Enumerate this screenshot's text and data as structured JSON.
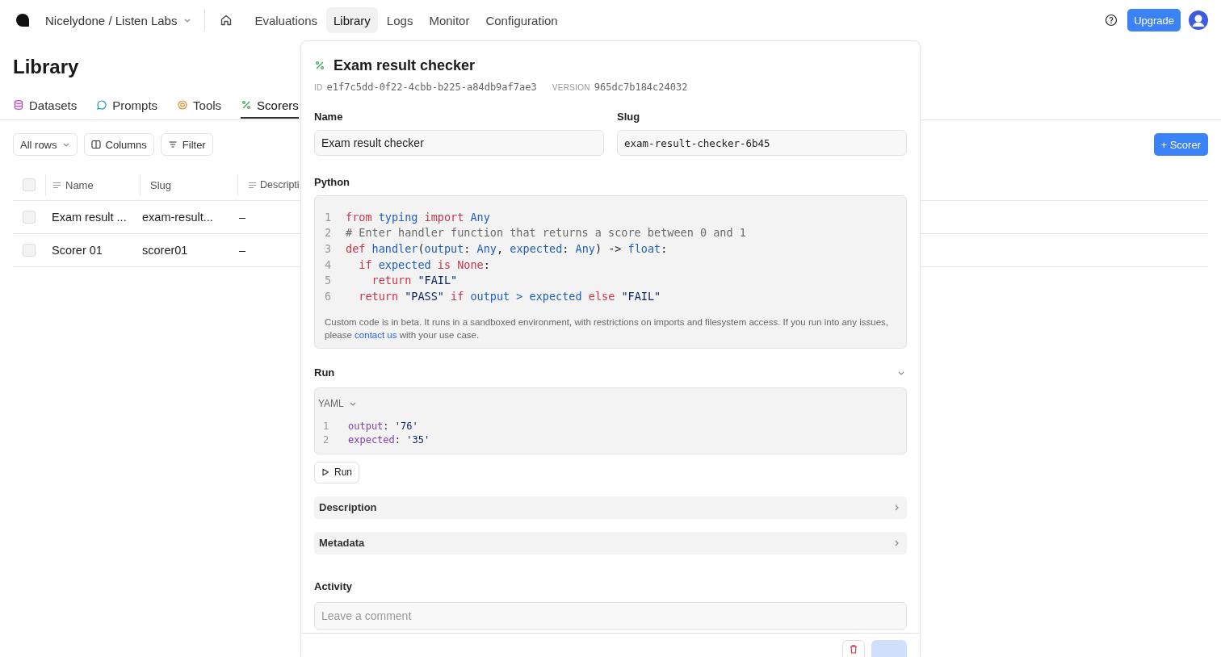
{
  "topbar": {
    "org": "Nicelydone / Listen Labs",
    "nav": [
      {
        "label": "Evaluations",
        "selected": false
      },
      {
        "label": "Library",
        "selected": true
      },
      {
        "label": "Logs",
        "selected": false
      },
      {
        "label": "Monitor",
        "selected": false
      },
      {
        "label": "Configuration",
        "selected": false
      }
    ],
    "upgrade": "Upgrade"
  },
  "page": {
    "title": "Library",
    "tabs": [
      {
        "label": "Datasets",
        "kind": "datasets",
        "selected": false
      },
      {
        "label": "Prompts",
        "kind": "prompts",
        "selected": false
      },
      {
        "label": "Tools",
        "kind": "tools",
        "selected": false
      },
      {
        "label": "Scorers",
        "kind": "scorers",
        "selected": true
      }
    ],
    "toolbar": {
      "rows": "All rows",
      "columns": "Columns",
      "filter": "Filter"
    },
    "add_button": "+ Scorer",
    "table": {
      "header_checked": false,
      "columns": [
        {
          "label": "Name",
          "sortable": true
        },
        {
          "label": "Slug",
          "sortable": false
        },
        {
          "label": "Descripti",
          "sortable": true
        }
      ],
      "rows": [
        {
          "checked": false,
          "cells": [
            "Exam result ...",
            "exam-result...",
            "–"
          ]
        },
        {
          "checked": false,
          "cells": [
            "Scorer 01",
            "scorer01",
            "–"
          ]
        }
      ]
    }
  },
  "panel": {
    "title": "Exam result checker",
    "id_label": "ID",
    "id": "e1f7c5dd-0f22-4cbb-b225-a84db9af7ae3",
    "version_label": "VERSION",
    "version": "965dc7b184c24032",
    "name_label": "Name",
    "name_value": "Exam result checker",
    "slug_label": "Slug",
    "slug_value": "exam-result-checker-6b45",
    "code_label": "Python",
    "code": [
      {
        "number": "1",
        "tokens": [
          {
            "text": "from ",
            "kind": "keyword"
          },
          {
            "text": "typing ",
            "kind": "name"
          },
          {
            "text": "import ",
            "kind": "keyword"
          },
          {
            "text": "Any",
            "kind": "name"
          }
        ]
      },
      {
        "number": "2",
        "tokens": [
          {
            "text": "# Enter handler function that returns a score between 0 and 1",
            "kind": "comment"
          }
        ]
      },
      {
        "number": "3",
        "tokens": [
          {
            "text": "def ",
            "kind": "keyword"
          },
          {
            "text": "handler",
            "kind": "name"
          },
          {
            "text": "(",
            "kind": "plain"
          },
          {
            "text": "output",
            "kind": "name"
          },
          {
            "text": ": ",
            "kind": "plain"
          },
          {
            "text": "Any",
            "kind": "name"
          },
          {
            "text": ", ",
            "kind": "plain"
          },
          {
            "text": "expected",
            "kind": "name"
          },
          {
            "text": ": ",
            "kind": "plain"
          },
          {
            "text": "Any",
            "kind": "name"
          },
          {
            "text": ") -> ",
            "kind": "plain"
          },
          {
            "text": "float",
            "kind": "name"
          },
          {
            "text": ":",
            "kind": "plain"
          }
        ]
      },
      {
        "number": "4",
        "tokens": [
          {
            "text": "  if ",
            "kind": "keyword"
          },
          {
            "text": "expected ",
            "kind": "name"
          },
          {
            "text": "is None",
            "kind": "keyword"
          },
          {
            "text": ":",
            "kind": "plain"
          }
        ]
      },
      {
        "number": "5",
        "tokens": [
          {
            "text": "    return ",
            "kind": "keyword"
          },
          {
            "text": "\"FAIL\"",
            "kind": "string"
          }
        ]
      },
      {
        "number": "6",
        "tokens": [
          {
            "text": "  return ",
            "kind": "keyword"
          },
          {
            "text": "\"PASS\" ",
            "kind": "string"
          },
          {
            "text": "if ",
            "kind": "keyword"
          },
          {
            "text": "output > expected ",
            "kind": "name"
          },
          {
            "text": "else ",
            "kind": "keyword"
          },
          {
            "text": "\"FAIL\"",
            "kind": "string"
          }
        ]
      }
    ],
    "note": [
      {
        "text": "Custom code is in beta. It runs in a sandboxed environment, with restrictions on imports and filesystem access. If you run into any issues, please ",
        "kind": "text"
      },
      {
        "text": "contact us",
        "kind": "link"
      },
      {
        "text": " with your use case.",
        "kind": "text"
      }
    ],
    "run_label": "Run",
    "run_expanded": true,
    "input_format": "YAML",
    "input": [
      {
        "number": "1",
        "tokens": [
          {
            "text": "output",
            "kind": "key"
          },
          {
            "text": ": ",
            "kind": "plain"
          },
          {
            "text": "'76'",
            "kind": "string"
          }
        ]
      },
      {
        "number": "2",
        "tokens": [
          {
            "text": "expected",
            "kind": "key"
          },
          {
            "text": ": ",
            "kind": "plain"
          },
          {
            "text": "'35'",
            "kind": "string"
          }
        ]
      }
    ],
    "run_button": "Run",
    "sections": [
      {
        "label": "Description",
        "expanded": false
      },
      {
        "label": "Metadata",
        "expanded": false
      }
    ],
    "activity_label": "Activity",
    "comment_placeholder": "Leave a comment"
  }
}
